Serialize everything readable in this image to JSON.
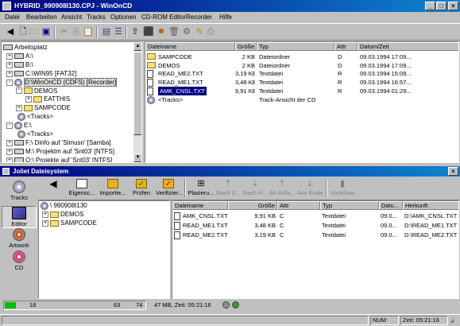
{
  "window": {
    "title": "HYBRID_990908I130.CPJ - WinOnCD"
  },
  "menu": [
    "Datei",
    "Bearbeiten",
    "Ansicht",
    "Tracks",
    "Optionen",
    "CD-ROM Editor",
    "Recorder",
    "Hilfe"
  ],
  "explorer": {
    "tree": [
      {
        "label": "Arbeitsplatz"
      },
      {
        "label": "A:\\"
      },
      {
        "label": "B:\\"
      },
      {
        "label": "C:\\WIN95 [FAT32]"
      },
      {
        "label": "D:\\WinOnCD (CDFS) [Recorder]"
      },
      {
        "label": "DEMOS"
      },
      {
        "label": "EATTHIS"
      },
      {
        "label": "SAMPCODE"
      },
      {
        "label": "<Tracks>"
      },
      {
        "label": "E:\\"
      },
      {
        "label": "<Tracks>"
      },
      {
        "label": "F:\\ Dinfo auf 'Slmusn' [Samba]"
      },
      {
        "label": "M:\\ Projektm auf 'Snt03' [NTFS]"
      },
      {
        "label": "Q:\\ Projekte auf 'Snt03' [NTFS]"
      }
    ],
    "columns": [
      "Dateiname",
      "Größe",
      "Typ",
      "Attr",
      "Datum/Zeit"
    ],
    "rows": [
      {
        "name": "SAMPCODE",
        "size": "2 KB",
        "type": "Dateiordner",
        "attr": "D",
        "date": "09.03.1994 17:09..."
      },
      {
        "name": "DEMOS",
        "size": "2 KB",
        "type": "Dateiordner",
        "attr": "D",
        "date": "09.03.1994 17:09..."
      },
      {
        "name": "READ_ME2.TXT",
        "size": "3,19 KB",
        "type": "Textdatei",
        "attr": "R",
        "date": "09.03.1994 15:09..."
      },
      {
        "name": "READ_ME1.TXT",
        "size": "3,48 KB",
        "type": "Textdatei",
        "attr": "R",
        "date": "09.03.1994 16:57..."
      },
      {
        "name": "AMK_CNSL.TXT",
        "size": "9,91 KB",
        "type": "Textdatei",
        "attr": "R",
        "date": "09.03.1994 01:29..."
      },
      {
        "name": "<Tracks>",
        "size": "",
        "type": "Track-Ansicht der CD",
        "attr": "",
        "date": ""
      }
    ]
  },
  "project": {
    "title": "Joliet Dateisystem",
    "side": [
      "Tracks",
      "Editor",
      "Artwork",
      "CD"
    ],
    "toolbar": [
      "Eigensc...",
      "Importie...",
      "Prüfen",
      "Verifizier...",
      "Plazieru...",
      "Nach V...",
      "Nach H...",
      "An Anfa...",
      "Ans Ende",
      "Vorschau"
    ],
    "tree": [
      {
        "label": "\\ 990908I130"
      },
      {
        "label": "DEMOS"
      },
      {
        "label": "SAMPCODE"
      }
    ],
    "columns": [
      "Dateiname",
      "Größe",
      "Attr",
      "Typ",
      "Datu...",
      "Herkunft"
    ],
    "rows": [
      {
        "name": "AMK_CNSL.TXT",
        "size": "9,91 KB",
        "attr": "C",
        "type": "Textdatei",
        "date": "09.0...",
        "src": "D:\\AMK_CNSL.TXT"
      },
      {
        "name": "READ_ME1.TXT",
        "size": "3,48 KB",
        "attr": "C",
        "type": "Textdatei",
        "date": "09.0...",
        "src": "D:\\READ_ME1.TXT"
      },
      {
        "name": "READ_ME2.TXT",
        "size": "3,19 KB",
        "attr": "C",
        "type": "Textdatei",
        "date": "09.0...",
        "src": "D:\\READ_ME2.TXT"
      }
    ]
  },
  "capacity": {
    "marks": [
      "18",
      "63",
      "74"
    ],
    "fill_fraction": 0.02,
    "info": "47 MB, Zeit: 05:21:16"
  },
  "status": {
    "num": "NUM",
    "time": "Zeit: 05:21:16"
  },
  "colors": {
    "title_from": "#000080",
    "title_to": "#1084d0",
    "capacity_fill": "#00c000"
  }
}
